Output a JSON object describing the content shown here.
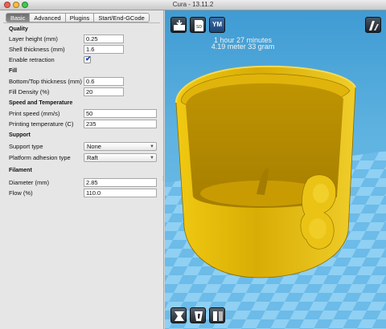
{
  "window": {
    "title": "Cura - 13.11.2"
  },
  "tabs": [
    {
      "label": "Basic",
      "active": true
    },
    {
      "label": "Advanced",
      "active": false
    },
    {
      "label": "Plugins",
      "active": false
    },
    {
      "label": "Start/End-GCode",
      "active": false
    }
  ],
  "quality": {
    "header": "Quality",
    "layer_height_label": "Layer height (mm)",
    "layer_height_value": "0.25",
    "shell_thickness_label": "Shell thickness (mm)",
    "shell_thickness_value": "1.6",
    "enable_retraction_label": "Enable retraction",
    "enable_retraction_checked": true
  },
  "fill": {
    "header": "Fill",
    "bottom_top_label": "Bottom/Top thickness (mm)",
    "bottom_top_value": "0.6",
    "fill_density_label": "Fill Density (%)",
    "fill_density_value": "20"
  },
  "speed": {
    "header": "Speed and Temperature",
    "print_speed_label": "Print speed (mm/s)",
    "print_speed_value": "50",
    "print_temp_label": "Printing temperature (C)",
    "print_temp_value": "235"
  },
  "support": {
    "header": "Support",
    "support_type_label": "Support type",
    "support_type_value": "None",
    "platform_adhesion_label": "Platform adhesion type",
    "platform_adhesion_value": "Raft"
  },
  "filament": {
    "header": "Filament",
    "diameter_label": "Diameter (mm)",
    "diameter_value": "2.85",
    "flow_label": "Flow (%)",
    "flow_value": "110.0"
  },
  "viewport": {
    "ym_label": "YM",
    "sd_label": "SD",
    "print_time": "1 hour 27 minutes",
    "material_usage": "4.19 meter 33 gram",
    "model_color": "#e2b808",
    "background_color": "#4aa5dc"
  },
  "icons": {
    "load": "load-model-icon",
    "sd": "save-sd-icon",
    "ym": "youmagine-icon",
    "view_mode": "view-mode-icon",
    "rotate": "rotate-icon",
    "scale": "scale-icon",
    "mirror": "mirror-icon"
  }
}
